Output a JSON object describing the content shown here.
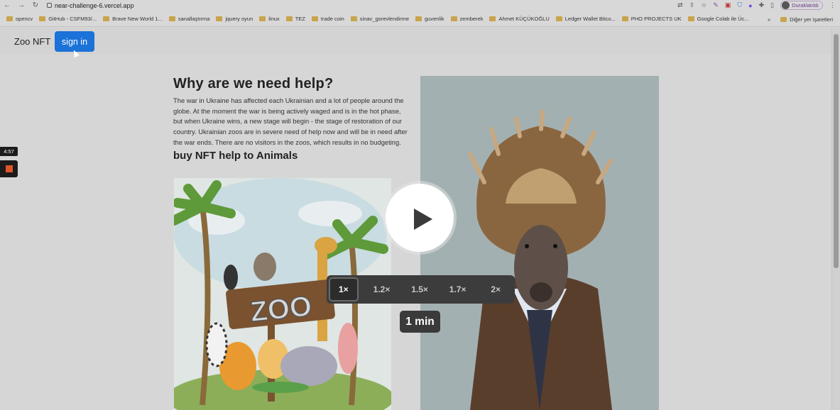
{
  "browser": {
    "url": "near-challenge-6.vercel.app",
    "profile_label": "Duraklatıldı",
    "bookmarks": [
      "opencv",
      "GitHub - CSFM93/...",
      "Brave New World 1...",
      "sanallaştırma",
      "jquery oyun",
      "linux",
      "TEZ",
      "trade coin",
      "sinav_gorevlendirme",
      "guvenlik",
      "zemberek",
      "Ahmet KÜÇÜKOĞLU",
      "Ledger Wallet Bitco...",
      "PHO PROJECTS UK",
      "Google Colab ile Üc..."
    ],
    "more_bookmarks": "»",
    "other_bookmarks": "Diğer yer işaretleri"
  },
  "site": {
    "brand": "Zoo NFT",
    "signin_label": "sign in",
    "heading": "Why are we need help?",
    "paragraph": "The war in Ukraine has affected each Ukrainian and a lot of people around the globe. At the moment the war is being actively waged and is in the hot phase, but when Ukraine wins, a new stage will begin - the stage of restoration of our country. Ukrainian zoos are in severe need of help now and will be in need after the war ends. There are no visitors in the zoos, which results in no budgeting.",
    "subheading": "buy NFT help to Animals",
    "zoo_sign": "ZOO"
  },
  "recorder": {
    "time": "4:57"
  },
  "player": {
    "speeds": [
      "1×",
      "1.2×",
      "1.5×",
      "1.7×",
      "2×"
    ],
    "active_speed": "1×",
    "duration": "1 min"
  }
}
